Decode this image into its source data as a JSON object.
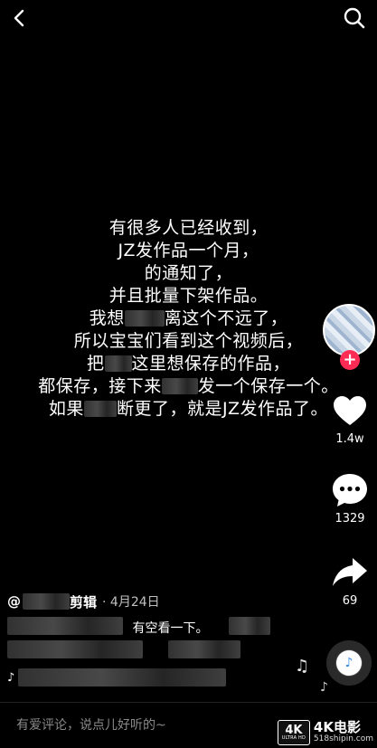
{
  "post": {
    "lines": [
      [
        "有很多人已经收到，"
      ],
      [
        "JZ发作品一个月，"
      ],
      [
        "的通知了，"
      ],
      [
        "并且批量下架作品。"
      ],
      [
        "我想",
        "",
        "离这个不远了，"
      ],
      [
        "所以宝宝们看到这个视频后，"
      ],
      [
        "把",
        "",
        "这里想保存的作品，"
      ],
      [
        "都保存，接下来",
        "",
        "发一个保存一个。"
      ],
      [
        "如果",
        "",
        "断更了，就是JZ发作品了。"
      ]
    ]
  },
  "rail": {
    "likes": "1.4w",
    "comments": "1329",
    "shares": "69",
    "follow_symbol": "+"
  },
  "caption": {
    "at_symbol": "@",
    "author_suffix": "剪辑",
    "date": "· 4月24日",
    "description_visible": "有空看一下。"
  },
  "comment_bar": {
    "placeholder": "有爱评论，说点儿好听的~"
  },
  "watermark": {
    "badge_text": "4K",
    "badge_sub": "ULTRA HD",
    "title": "4K电影",
    "site": "518shipin.com"
  },
  "icons": {
    "back": "chevron-left-icon",
    "search": "search-icon",
    "like": "heart-icon",
    "comment": "comment-icon",
    "share": "share-icon",
    "music": "music-note-icon"
  },
  "colors": {
    "background": "#000000",
    "follow_accent": "#fe2c55",
    "text": "#ffffff"
  }
}
